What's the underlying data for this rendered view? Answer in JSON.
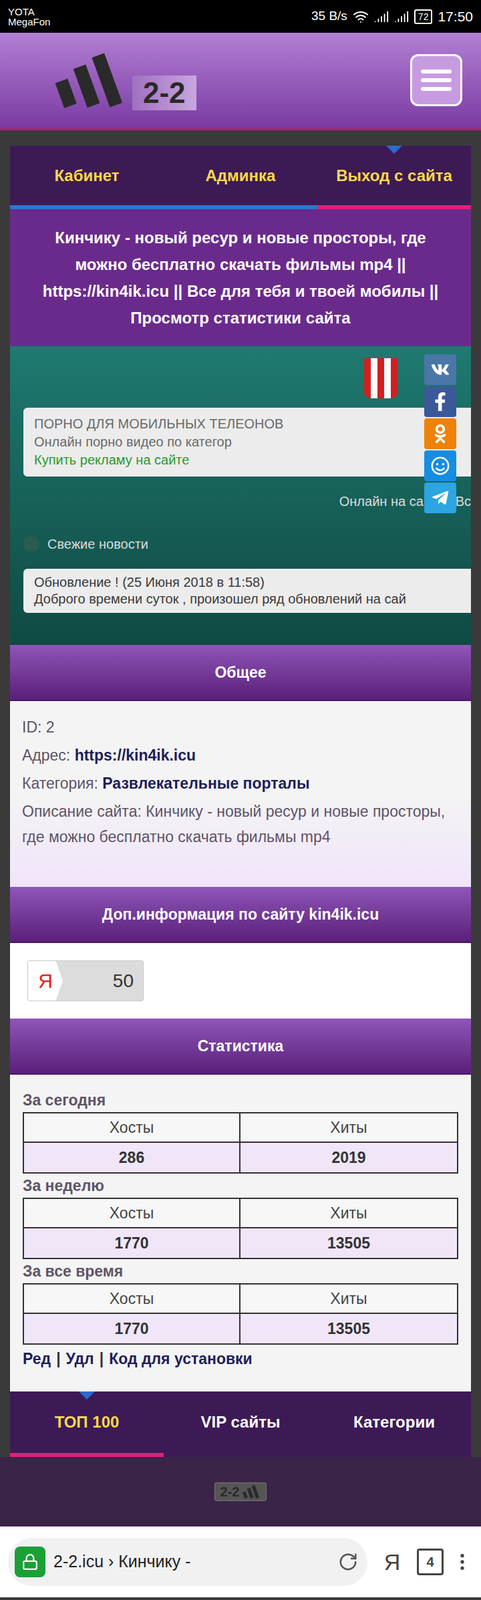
{
  "status_bar": {
    "carrier1": "YOTA",
    "carrier2": "MegaFon",
    "speed": "35 B/s",
    "battery": "72",
    "time": "17:50"
  },
  "header": {
    "logo": "2-2"
  },
  "top_nav": [
    {
      "label": "Кабинет",
      "selected": false
    },
    {
      "label": "Админка",
      "selected": false
    },
    {
      "label": "Выход с сайта",
      "selected": true
    }
  ],
  "title": "Кинчику - новый ресур и новые просторы, где можно бесплатно скачать фильмы mp4 || https://kin4ik.icu || Все для тебя и твоей мобилы || Просмотр статистики сайта",
  "preview": {
    "ad_title": "ПОРНО ДЛЯ МОБИЛЬНЫХ ТЕЛЕОНОВ",
    "ad_sub": "Онлайн порно видео по категор",
    "ad_link": "Купить рекламу на сайте",
    "online": "Онлайн на сайте . Вс",
    "news_header": "Свежие новости",
    "news_title": "Обновление ! (25 Июня 2018 в 11:58)",
    "news_text": "Доброго времени суток , произошел ряд обновлений на сай"
  },
  "share": [
    {
      "kind": "vk",
      "color": "#4a76a8"
    },
    {
      "kind": "facebook",
      "color": "#3b5998"
    },
    {
      "kind": "ok",
      "color": "#ee8208"
    },
    {
      "kind": "mail",
      "color": "#168de2"
    },
    {
      "kind": "telegram",
      "color": "#2ca5e0"
    }
  ],
  "general": {
    "header": "Общее",
    "items": [
      {
        "label": "ID:",
        "value": "2",
        "kind": "plain"
      },
      {
        "label": "Адрес:",
        "value": "https://kin4ik.icu",
        "kind": "link"
      },
      {
        "label": "Категория:",
        "value": "Развлекательные порталы",
        "kind": "link"
      },
      {
        "label": "Описание сайта:",
        "value": "Кинчику - новый ресур и новые просторы, где можно бесплатно скачать фильмы mp4",
        "kind": "plain"
      }
    ]
  },
  "extra": {
    "header": "Доп.информация по сайту kin4ik.icu",
    "badge_letter": "Я",
    "badge_value": "50"
  },
  "stats": {
    "header": "Статистика",
    "periods": [
      {
        "label": "За сегодня",
        "columns": [
          "Хосты",
          "Хиты"
        ],
        "values": [
          "286",
          "2019"
        ]
      },
      {
        "label": "За неделю",
        "columns": [
          "Хосты",
          "Хиты"
        ],
        "values": [
          "1770",
          "13505"
        ]
      },
      {
        "label": "За все время",
        "columns": [
          "Хосты",
          "Хиты"
        ],
        "values": [
          "1770",
          "13505"
        ]
      }
    ],
    "actions": [
      "Ред",
      "Удл",
      "Код для установки"
    ],
    "separator": "|"
  },
  "bottom_nav": [
    {
      "label": "ТОП 100",
      "selected": true
    },
    {
      "label": "VIP сайты",
      "selected": false
    },
    {
      "label": "Категории",
      "selected": false
    }
  ],
  "footer": {
    "logo": "2-2"
  },
  "browser": {
    "url": "2-2.icu › Кинчику - ",
    "search_letter": "Я",
    "tabs": "4"
  }
}
